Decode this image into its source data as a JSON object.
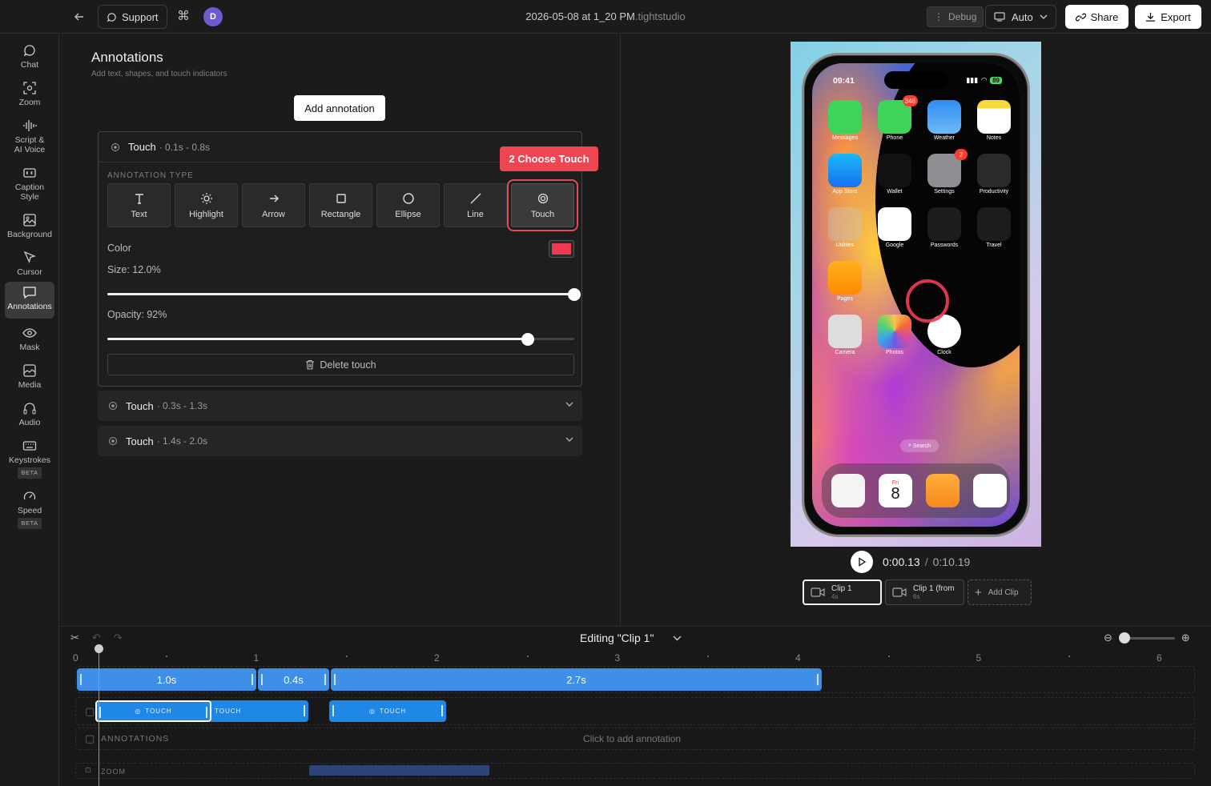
{
  "topbar": {
    "support_label": "Support",
    "avatar_initial": "D",
    "file_name": "2026-05-08 at 1_20 PM",
    "file_ext": ".tightstudio",
    "debug_label": "Debug",
    "auto_label": "Auto",
    "share_label": "Share",
    "export_label": "Export"
  },
  "sidebar": {
    "items": [
      {
        "label": "Chat",
        "icon": "chat-icon"
      },
      {
        "label": "Zoom",
        "icon": "zoom-icon"
      },
      {
        "label": "Script &\nAI Voice",
        "icon": "waveform-icon"
      },
      {
        "label": "Caption\nStyle",
        "icon": "caption-icon"
      },
      {
        "label": "Background",
        "icon": "image-icon"
      },
      {
        "label": "Cursor",
        "icon": "cursor-icon"
      },
      {
        "label": "Annotations",
        "icon": "annotation-icon",
        "active": true
      },
      {
        "label": "Mask",
        "icon": "eye-icon"
      },
      {
        "label": "Media",
        "icon": "media-icon"
      },
      {
        "label": "Audio",
        "icon": "headphones-icon"
      },
      {
        "label": "Keystrokes",
        "icon": "keyboard-icon",
        "badge": "BETA"
      },
      {
        "label": "Speed",
        "icon": "gauge-icon",
        "badge": "BETA"
      }
    ]
  },
  "panel": {
    "title": "Annotations",
    "subtitle": "Add text, shapes, and touch indicators",
    "add_button": "Add annotation",
    "open_card": {
      "name": "Touch",
      "time": "· 0.1s - 0.8s",
      "type_label": "ANNOTATION TYPE",
      "types": [
        "Text",
        "Highlight",
        "Arrow",
        "Rectangle",
        "Ellipse",
        "Line",
        "Touch"
      ],
      "selected_type": "Touch",
      "color_label": "Color",
      "color": "#ef3b52",
      "size_label": "Size: 12.0%",
      "size_value": 1.0,
      "opacity_label": "Opacity: 92%",
      "opacity_value": 0.9,
      "delete_label": "Delete touch"
    },
    "callout": "2 Choose Touch",
    "closed_cards": [
      {
        "name": "Touch",
        "time": "· 0.3s - 1.3s"
      },
      {
        "name": "Touch",
        "time": "· 1.4s - 2.0s"
      }
    ]
  },
  "preview": {
    "status_time": "09:41",
    "battery": "89",
    "apps": [
      {
        "label": "Messages"
      },
      {
        "label": "Phone",
        "badge": "348"
      },
      {
        "label": "Weather"
      },
      {
        "label": "Notes"
      },
      {
        "label": "App Store"
      },
      {
        "label": "Wallet"
      },
      {
        "label": "Settings",
        "badge": "2"
      },
      {
        "label": "Productivity"
      },
      {
        "label": "Utilities"
      },
      {
        "label": "Google"
      },
      {
        "label": "Passwords"
      },
      {
        "label": "Travel"
      },
      {
        "label": "Pages"
      },
      {
        "label": "Camera"
      },
      {
        "label": "Photos"
      },
      {
        "label": "Clock"
      }
    ],
    "search_label": "Search",
    "dock_calendar_day": "Fri",
    "dock_calendar_date": "8",
    "time_now": "0:00.13",
    "time_sep": "/",
    "time_total": "0:10.19",
    "clips": [
      {
        "name": "Clip 1",
        "dur": "4s"
      },
      {
        "name": "Clip 1 (from",
        "dur": "6s"
      }
    ],
    "add_clip": "Add Clip"
  },
  "timeline": {
    "editing_label": "Editing \"Clip 1\"",
    "ruler": [
      "0",
      "1",
      "2",
      "3",
      "4",
      "5",
      "6"
    ],
    "segments": [
      "1.0s",
      "0.4s",
      "2.7s"
    ],
    "touch_chip_label": "TOUCH",
    "annotations_label": "ANNOTATIONS",
    "click_add": "Click to add annotation",
    "zoom_label": "ZOOM"
  },
  "colors": {
    "accent_red": "#ef4451",
    "clip_blue": "#3f8ee8",
    "touch_blue": "#1f87e6"
  }
}
